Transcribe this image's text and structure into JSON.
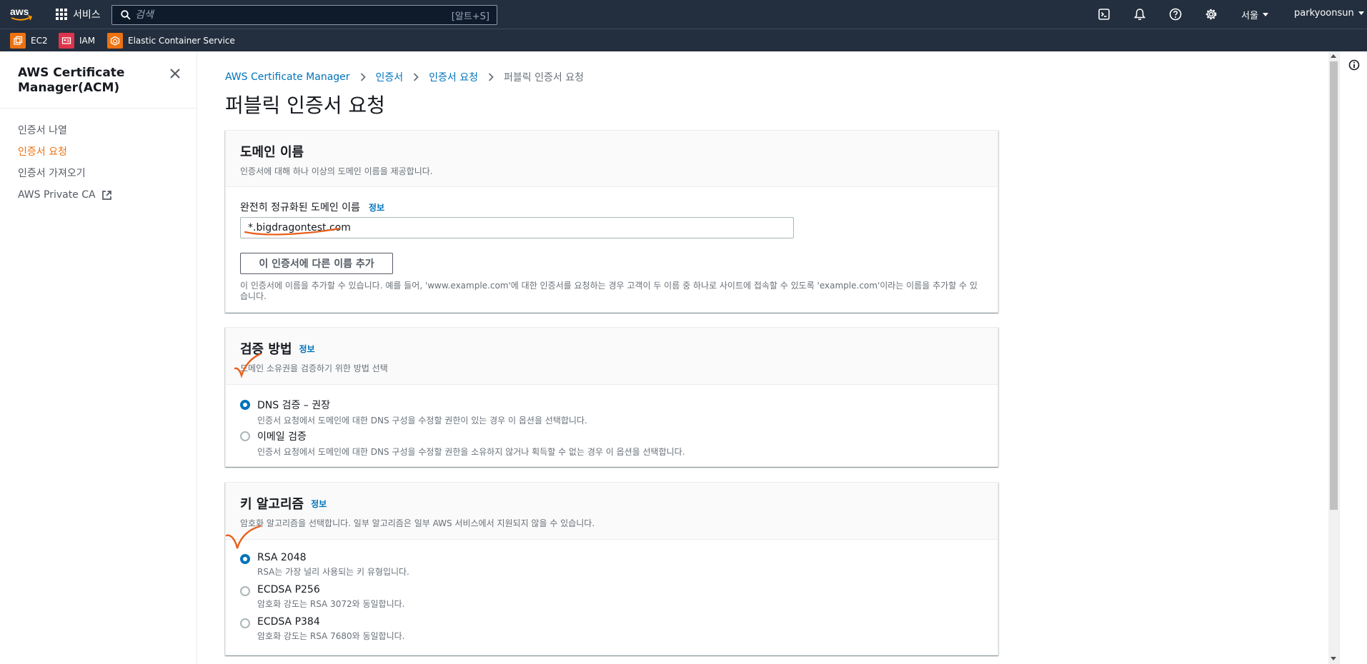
{
  "topnav": {
    "logo_text": "aws",
    "services_label": "서비스",
    "search_placeholder": "검색",
    "search_shortcut": "[알트+S]",
    "region_label": "서울",
    "user_label": "parkyoonsun"
  },
  "favorites": [
    {
      "label": "EC2",
      "color": "#ec7211"
    },
    {
      "label": "IAM",
      "color": "#dd344c"
    },
    {
      "label": "Elastic Container Service",
      "color": "#ec7211"
    }
  ],
  "sidenav": {
    "title": "AWS Certificate Manager(ACM)",
    "items": [
      {
        "label": "인증서 나열",
        "active": false
      },
      {
        "label": "인증서 요청",
        "active": true
      },
      {
        "label": "인증서 가져오기",
        "active": false
      },
      {
        "label": "AWS Private CA",
        "active": false,
        "external": true
      }
    ]
  },
  "breadcrumb": [
    "AWS Certificate Manager",
    "인증서",
    "인증서 요청",
    "퍼블릭 인증서 요청"
  ],
  "page_title": "퍼블릭 인증서 요청",
  "domain_section": {
    "title": "도메인 이름",
    "description": "인증서에 대해 하나 이상의 도메인 이름을 제공합니다.",
    "field_label": "완전히 정규화된 도메인 이름",
    "info": "정보",
    "input_value": "*.bigdragontest.com",
    "add_button": "이 인증서에 다른 이름 추가",
    "help_text": "이 인증서에 이름을 추가할 수 있습니다. 예를 들어, 'www.example.com'에 대한 인증서를 요청하는 경우 고객이 두 이름 중 하나로 사이트에 접속할 수 있도록 'example.com'이라는 이름을 추가할 수 있습니다."
  },
  "validation_section": {
    "title": "검증 방법",
    "info": "정보",
    "description": "도메인 소유권을 검증하기 위한 방법 선택",
    "options": [
      {
        "label": "DNS 검증 – 권장",
        "description": "인증서 요청에서 도메인에 대한 DNS 구성을 수정할 권한이 있는 경우 이 옵션을 선택합니다.",
        "checked": true
      },
      {
        "label": "이메일 검증",
        "description": "인증서 요청에서 도메인에 대한 DNS 구성을 수정할 권한을 소유하지 않거나 획득할 수 없는 경우 이 옵션을 선택합니다.",
        "checked": false
      }
    ]
  },
  "key_section": {
    "title": "키 알고리즘",
    "info": "정보",
    "description": "암호화 알고리즘을 선택합니다. 일부 알고리즘은 일부 AWS 서비스에서 지원되지 않을 수 있습니다.",
    "options": [
      {
        "label": "RSA 2048",
        "description": "RSA는 가장 널리 사용되는 키 유형입니다.",
        "checked": true
      },
      {
        "label": "ECDSA P256",
        "description": "암호화 강도는 RSA 3072와 동일합니다.",
        "checked": false
      },
      {
        "label": "ECDSA P384",
        "description": "암호화 강도는 RSA 7680와 동일합니다.",
        "checked": false
      }
    ]
  },
  "colors": {
    "nav_bg": "#232f3e",
    "link": "#0073bb",
    "active": "#ec7211",
    "annotation": "#e8601c"
  }
}
